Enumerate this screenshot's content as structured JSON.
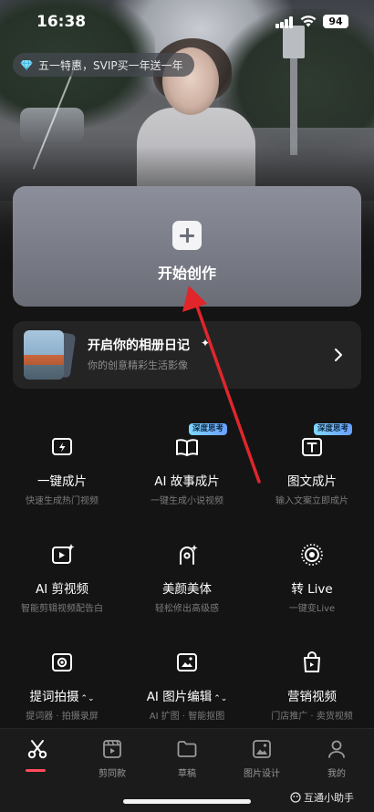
{
  "status_bar": {
    "time": "16:38",
    "battery": "94"
  },
  "promo": {
    "text": "五一特惠，SVIP买一年送一年",
    "icon": "diamond-icon"
  },
  "create_card": {
    "label": "开始创作",
    "icon": "plus-icon"
  },
  "album_card": {
    "title": "开启你的相册日记",
    "spark": "✦",
    "subtitle": "你的创意精彩生活影像",
    "icon": "chevron-right-icon"
  },
  "features": [
    {
      "name": "一键成片",
      "desc": "快速生成热门视频",
      "icon": "lightning-play-icon",
      "badge": ""
    },
    {
      "name": "AI 故事成片",
      "desc": "一键生成小说视频",
      "icon": "book-icon",
      "badge": "深度思考"
    },
    {
      "name": "图文成片",
      "desc": "输入文案立即成片",
      "icon": "text-frame-icon",
      "badge": "深度思考"
    },
    {
      "name": "AI 剪视频",
      "desc": "智能剪辑视频配告白",
      "icon": "play-spark-icon",
      "badge": ""
    },
    {
      "name": "美颜美体",
      "desc": "轻松修出高级感",
      "icon": "face-beauty-icon",
      "badge": ""
    },
    {
      "name": "转 Live",
      "desc": "一键变Live",
      "icon": "live-icon",
      "badge": ""
    },
    {
      "name": "提词拍摄",
      "desc": "提词器 · 拍摄录屏",
      "icon": "camera-record-icon",
      "badge": "",
      "chevron": "⌃⌄"
    },
    {
      "name": "AI 图片编辑",
      "desc": "AI 扩图 · 智能抠图",
      "icon": "image-edit-icon",
      "badge": "",
      "chevron": "⌃⌄"
    },
    {
      "name": "营销视频",
      "desc": "门店推广 · 卖货视频",
      "icon": "shopping-bag-icon",
      "badge": ""
    }
  ],
  "nav": [
    {
      "label": "",
      "icon": "scissors-icon",
      "active": true
    },
    {
      "label": "剪同款",
      "icon": "template-icon"
    },
    {
      "label": "草稿",
      "icon": "folder-icon"
    },
    {
      "label": "图片设计",
      "icon": "image-icon"
    },
    {
      "label": "我的",
      "icon": "profile-icon"
    }
  ],
  "watermark": {
    "text": "互通小助手"
  },
  "colors": {
    "accent_red": "#ff4b5c",
    "annotation_arrow": "#e0262b"
  }
}
